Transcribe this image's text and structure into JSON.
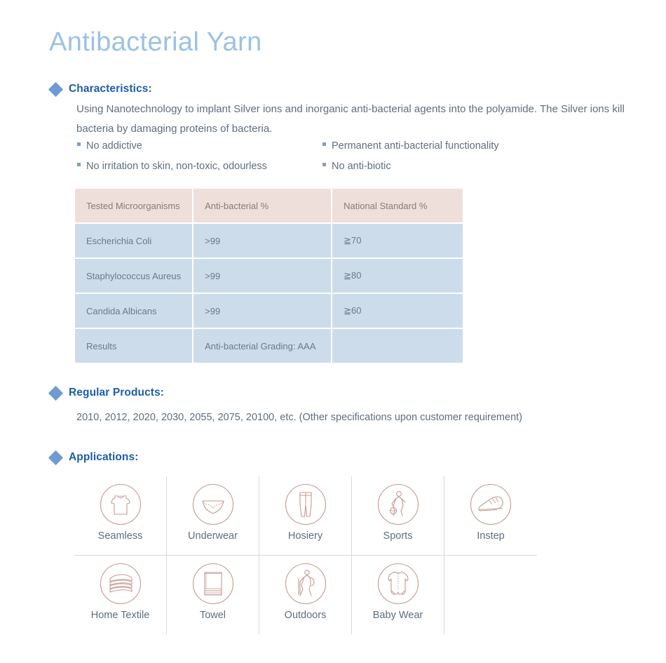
{
  "title": "Antibacterial Yarn",
  "colors": {
    "title": "#9cc2e2",
    "heading": "#1d5da8",
    "diamond": "#6f9bd1",
    "body_text": "#5f6e7d",
    "table_header_bg": "#eedfdb",
    "table_row_bg": "#ccdcea",
    "icon_stroke": "#c49a90",
    "divider": "#d8d8d8"
  },
  "characteristics": {
    "heading": "Characteristics:",
    "paragraph": "Using Nanotechnology to implant Silver ions and inorganic anti-bacterial agents into the polyamide. The Silver ions kill bacteria by damaging proteins of bacteria.",
    "features": [
      "No addictive",
      "Permanent anti-bacterial functionality",
      "No irritation to skin, non-toxic, odourless",
      "No anti-biotic"
    ]
  },
  "table": {
    "headers": [
      "Tested Microorganisms",
      "Anti-bacterial %",
      "National Standard %"
    ],
    "rows": [
      [
        "Escherichia Coli",
        ">99",
        "≧70"
      ],
      [
        "Staphylococcus Aureus",
        ">99",
        "≧80"
      ],
      [
        "Candida Albicans",
        ">99",
        "≧60"
      ],
      [
        "Results",
        "Anti-bacterial Grading: AAA",
        ""
      ]
    ]
  },
  "regular_products": {
    "heading": "Regular Products:",
    "text": "2010, 2012, 2020, 2030, 2055, 2075, 20100, etc. (Other specifications upon customer requirement)"
  },
  "applications": {
    "heading": "Applications:",
    "row1": [
      {
        "label": "Seamless",
        "icon": "tank-top-icon"
      },
      {
        "label": "Underwear",
        "icon": "briefs-icon"
      },
      {
        "label": "Hosiery",
        "icon": "leggings-icon"
      },
      {
        "label": "Sports",
        "icon": "basketball-player-icon"
      },
      {
        "label": "Instep",
        "icon": "sneaker-icon"
      }
    ],
    "row2": [
      {
        "label": "Home Textile",
        "icon": "folded-towels-icon"
      },
      {
        "label": "Towel",
        "icon": "towel-icon"
      },
      {
        "label": "Outdoors",
        "icon": "hiker-icon"
      },
      {
        "label": "Baby Wear",
        "icon": "onesie-icon"
      }
    ]
  }
}
